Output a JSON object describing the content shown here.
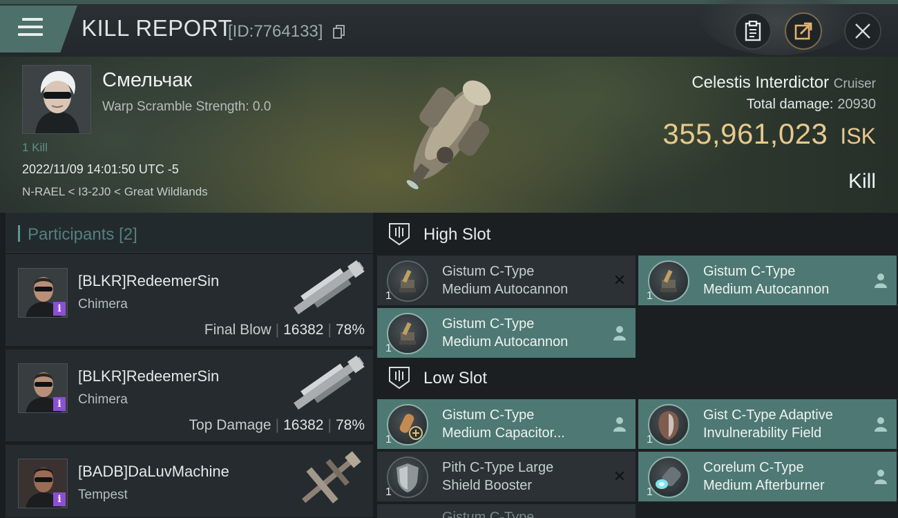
{
  "header": {
    "title": "KILL REPORT",
    "report_id": "[ID:7764133]",
    "icons": {
      "menu": "menu-icon",
      "copy": "copy-icon",
      "clipboard": "clipboard-icon",
      "share": "share-icon",
      "close": "close-icon"
    }
  },
  "victim": {
    "name": "Смельчак",
    "warp_scramble": "Warp Scramble Strength: 0.0",
    "kills": "1 Kill",
    "timestamp": "2022/11/09 14:01:50 UTC -5",
    "location": "N-RAEL < I3-2J0 < Great Wildlands",
    "ship": "Celestis Interdictor",
    "ship_class": "Cruiser",
    "total_damage_label": "Total damage:",
    "total_damage": "20930",
    "isk_value": "355,961,023",
    "isk_unit": "ISK",
    "type": "Kill"
  },
  "participants": {
    "title": "Participants",
    "count": "[2]",
    "items": [
      {
        "name": "[BLKR]RedeemerSin",
        "ship": "Chimera",
        "role": "Final Blow",
        "damage": "16382",
        "percent": "78%"
      },
      {
        "name": "[BLKR]RedeemerSin",
        "ship": "Chimera",
        "role": "Top Damage",
        "damage": "16382",
        "percent": "78%"
      },
      {
        "name": "[BADB]DaLuvMachine",
        "ship": "Tempest"
      }
    ]
  },
  "fitting": {
    "high_slot": {
      "title": "High Slot",
      "modules": [
        {
          "line1": "Gistum C-Type",
          "line2": "Medium Autocannon",
          "qty": "1",
          "state": "destroyed"
        },
        {
          "line1": "Gistum C-Type",
          "line2": "Medium Autocannon",
          "qty": "1",
          "state": "dropped"
        },
        {
          "line1": "Gistum C-Type",
          "line2": "Medium Autocannon",
          "qty": "1",
          "state": "dropped"
        }
      ]
    },
    "low_slot": {
      "title": "Low Slot",
      "modules": [
        {
          "line1": "Gistum C-Type",
          "line2": "Medium Capacitor...",
          "qty": "1",
          "state": "dropped"
        },
        {
          "line1": "Gist C-Type Adaptive",
          "line2": "Invulnerability Field",
          "qty": "1",
          "state": "dropped"
        },
        {
          "line1": "Pith C-Type Large",
          "line2": "Shield Booster",
          "qty": "1",
          "state": "destroyed"
        },
        {
          "line1": "Corelum C-Type",
          "line2": "Medium Afterburner",
          "qty": "1",
          "state": "dropped"
        }
      ]
    },
    "next_row": {
      "line1": "Gistum C-Type"
    }
  },
  "colors": {
    "accent": "#4e7873",
    "isk": "#e7c98d",
    "info_badge": "#8d4fd1"
  }
}
